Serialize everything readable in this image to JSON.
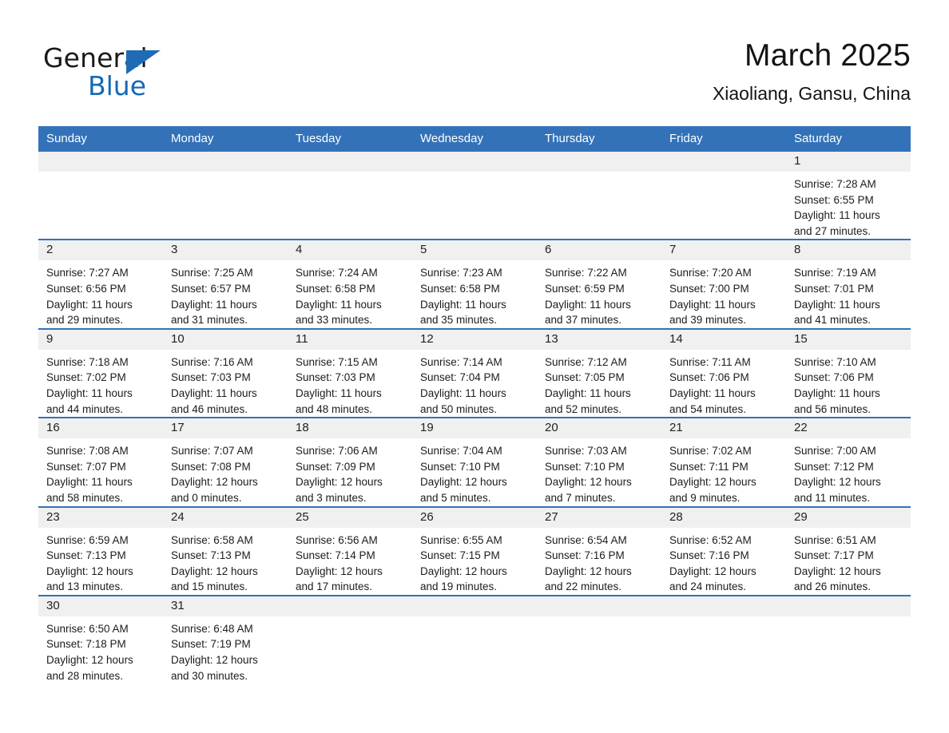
{
  "logo": {
    "word_one": "General",
    "word_two": "Blue",
    "triangle_icon": "blue-triangle-icon",
    "colors": {
      "general": "#1a1a1a",
      "blue": "#1669b5",
      "triangle": "#1e6cb5"
    }
  },
  "header": {
    "title": "March 2025",
    "subtitle": "Xiaoliang, Gansu, China"
  },
  "colors": {
    "header_blue": "#3372b8",
    "row_separator": "#3372b8",
    "daynum_band": "#f0f0f0",
    "cell_background": "#ffffff",
    "text": "#1c1c1c"
  },
  "weekday_headers": [
    "Sunday",
    "Monday",
    "Tuesday",
    "Wednesday",
    "Thursday",
    "Friday",
    "Saturday"
  ],
  "weeks": [
    [
      {
        "day": "",
        "blank": true,
        "sunrise": "",
        "sunset": "",
        "daylight_line1": "",
        "daylight_line2": ""
      },
      {
        "day": "",
        "blank": true,
        "sunrise": "",
        "sunset": "",
        "daylight_line1": "",
        "daylight_line2": ""
      },
      {
        "day": "",
        "blank": true,
        "sunrise": "",
        "sunset": "",
        "daylight_line1": "",
        "daylight_line2": ""
      },
      {
        "day": "",
        "blank": true,
        "sunrise": "",
        "sunset": "",
        "daylight_line1": "",
        "daylight_line2": ""
      },
      {
        "day": "",
        "blank": true,
        "sunrise": "",
        "sunset": "",
        "daylight_line1": "",
        "daylight_line2": ""
      },
      {
        "day": "",
        "blank": true,
        "sunrise": "",
        "sunset": "",
        "daylight_line1": "",
        "daylight_line2": ""
      },
      {
        "day": "1",
        "blank": false,
        "sunrise": "Sunrise: 7:28 AM",
        "sunset": "Sunset: 6:55 PM",
        "daylight_line1": "Daylight: 11 hours",
        "daylight_line2": "and 27 minutes."
      }
    ],
    [
      {
        "day": "2",
        "blank": false,
        "sunrise": "Sunrise: 7:27 AM",
        "sunset": "Sunset: 6:56 PM",
        "daylight_line1": "Daylight: 11 hours",
        "daylight_line2": "and 29 minutes."
      },
      {
        "day": "3",
        "blank": false,
        "sunrise": "Sunrise: 7:25 AM",
        "sunset": "Sunset: 6:57 PM",
        "daylight_line1": "Daylight: 11 hours",
        "daylight_line2": "and 31 minutes."
      },
      {
        "day": "4",
        "blank": false,
        "sunrise": "Sunrise: 7:24 AM",
        "sunset": "Sunset: 6:58 PM",
        "daylight_line1": "Daylight: 11 hours",
        "daylight_line2": "and 33 minutes."
      },
      {
        "day": "5",
        "blank": false,
        "sunrise": "Sunrise: 7:23 AM",
        "sunset": "Sunset: 6:58 PM",
        "daylight_line1": "Daylight: 11 hours",
        "daylight_line2": "and 35 minutes."
      },
      {
        "day": "6",
        "blank": false,
        "sunrise": "Sunrise: 7:22 AM",
        "sunset": "Sunset: 6:59 PM",
        "daylight_line1": "Daylight: 11 hours",
        "daylight_line2": "and 37 minutes."
      },
      {
        "day": "7",
        "blank": false,
        "sunrise": "Sunrise: 7:20 AM",
        "sunset": "Sunset: 7:00 PM",
        "daylight_line1": "Daylight: 11 hours",
        "daylight_line2": "and 39 minutes."
      },
      {
        "day": "8",
        "blank": false,
        "sunrise": "Sunrise: 7:19 AM",
        "sunset": "Sunset: 7:01 PM",
        "daylight_line1": "Daylight: 11 hours",
        "daylight_line2": "and 41 minutes."
      }
    ],
    [
      {
        "day": "9",
        "blank": false,
        "sunrise": "Sunrise: 7:18 AM",
        "sunset": "Sunset: 7:02 PM",
        "daylight_line1": "Daylight: 11 hours",
        "daylight_line2": "and 44 minutes."
      },
      {
        "day": "10",
        "blank": false,
        "sunrise": "Sunrise: 7:16 AM",
        "sunset": "Sunset: 7:03 PM",
        "daylight_line1": "Daylight: 11 hours",
        "daylight_line2": "and 46 minutes."
      },
      {
        "day": "11",
        "blank": false,
        "sunrise": "Sunrise: 7:15 AM",
        "sunset": "Sunset: 7:03 PM",
        "daylight_line1": "Daylight: 11 hours",
        "daylight_line2": "and 48 minutes."
      },
      {
        "day": "12",
        "blank": false,
        "sunrise": "Sunrise: 7:14 AM",
        "sunset": "Sunset: 7:04 PM",
        "daylight_line1": "Daylight: 11 hours",
        "daylight_line2": "and 50 minutes."
      },
      {
        "day": "13",
        "blank": false,
        "sunrise": "Sunrise: 7:12 AM",
        "sunset": "Sunset: 7:05 PM",
        "daylight_line1": "Daylight: 11 hours",
        "daylight_line2": "and 52 minutes."
      },
      {
        "day": "14",
        "blank": false,
        "sunrise": "Sunrise: 7:11 AM",
        "sunset": "Sunset: 7:06 PM",
        "daylight_line1": "Daylight: 11 hours",
        "daylight_line2": "and 54 minutes."
      },
      {
        "day": "15",
        "blank": false,
        "sunrise": "Sunrise: 7:10 AM",
        "sunset": "Sunset: 7:06 PM",
        "daylight_line1": "Daylight: 11 hours",
        "daylight_line2": "and 56 minutes."
      }
    ],
    [
      {
        "day": "16",
        "blank": false,
        "sunrise": "Sunrise: 7:08 AM",
        "sunset": "Sunset: 7:07 PM",
        "daylight_line1": "Daylight: 11 hours",
        "daylight_line2": "and 58 minutes."
      },
      {
        "day": "17",
        "blank": false,
        "sunrise": "Sunrise: 7:07 AM",
        "sunset": "Sunset: 7:08 PM",
        "daylight_line1": "Daylight: 12 hours",
        "daylight_line2": "and 0 minutes."
      },
      {
        "day": "18",
        "blank": false,
        "sunrise": "Sunrise: 7:06 AM",
        "sunset": "Sunset: 7:09 PM",
        "daylight_line1": "Daylight: 12 hours",
        "daylight_line2": "and 3 minutes."
      },
      {
        "day": "19",
        "blank": false,
        "sunrise": "Sunrise: 7:04 AM",
        "sunset": "Sunset: 7:10 PM",
        "daylight_line1": "Daylight: 12 hours",
        "daylight_line2": "and 5 minutes."
      },
      {
        "day": "20",
        "blank": false,
        "sunrise": "Sunrise: 7:03 AM",
        "sunset": "Sunset: 7:10 PM",
        "daylight_line1": "Daylight: 12 hours",
        "daylight_line2": "and 7 minutes."
      },
      {
        "day": "21",
        "blank": false,
        "sunrise": "Sunrise: 7:02 AM",
        "sunset": "Sunset: 7:11 PM",
        "daylight_line1": "Daylight: 12 hours",
        "daylight_line2": "and 9 minutes."
      },
      {
        "day": "22",
        "blank": false,
        "sunrise": "Sunrise: 7:00 AM",
        "sunset": "Sunset: 7:12 PM",
        "daylight_line1": "Daylight: 12 hours",
        "daylight_line2": "and 11 minutes."
      }
    ],
    [
      {
        "day": "23",
        "blank": false,
        "sunrise": "Sunrise: 6:59 AM",
        "sunset": "Sunset: 7:13 PM",
        "daylight_line1": "Daylight: 12 hours",
        "daylight_line2": "and 13 minutes."
      },
      {
        "day": "24",
        "blank": false,
        "sunrise": "Sunrise: 6:58 AM",
        "sunset": "Sunset: 7:13 PM",
        "daylight_line1": "Daylight: 12 hours",
        "daylight_line2": "and 15 minutes."
      },
      {
        "day": "25",
        "blank": false,
        "sunrise": "Sunrise: 6:56 AM",
        "sunset": "Sunset: 7:14 PM",
        "daylight_line1": "Daylight: 12 hours",
        "daylight_line2": "and 17 minutes."
      },
      {
        "day": "26",
        "blank": false,
        "sunrise": "Sunrise: 6:55 AM",
        "sunset": "Sunset: 7:15 PM",
        "daylight_line1": "Daylight: 12 hours",
        "daylight_line2": "and 19 minutes."
      },
      {
        "day": "27",
        "blank": false,
        "sunrise": "Sunrise: 6:54 AM",
        "sunset": "Sunset: 7:16 PM",
        "daylight_line1": "Daylight: 12 hours",
        "daylight_line2": "and 22 minutes."
      },
      {
        "day": "28",
        "blank": false,
        "sunrise": "Sunrise: 6:52 AM",
        "sunset": "Sunset: 7:16 PM",
        "daylight_line1": "Daylight: 12 hours",
        "daylight_line2": "and 24 minutes."
      },
      {
        "day": "29",
        "blank": false,
        "sunrise": "Sunrise: 6:51 AM",
        "sunset": "Sunset: 7:17 PM",
        "daylight_line1": "Daylight: 12 hours",
        "daylight_line2": "and 26 minutes."
      }
    ],
    [
      {
        "day": "30",
        "blank": false,
        "sunrise": "Sunrise: 6:50 AM",
        "sunset": "Sunset: 7:18 PM",
        "daylight_line1": "Daylight: 12 hours",
        "daylight_line2": "and 28 minutes."
      },
      {
        "day": "31",
        "blank": false,
        "sunrise": "Sunrise: 6:48 AM",
        "sunset": "Sunset: 7:19 PM",
        "daylight_line1": "Daylight: 12 hours",
        "daylight_line2": "and 30 minutes."
      },
      {
        "day": "",
        "blank": true,
        "sunrise": "",
        "sunset": "",
        "daylight_line1": "",
        "daylight_line2": ""
      },
      {
        "day": "",
        "blank": true,
        "sunrise": "",
        "sunset": "",
        "daylight_line1": "",
        "daylight_line2": ""
      },
      {
        "day": "",
        "blank": true,
        "sunrise": "",
        "sunset": "",
        "daylight_line1": "",
        "daylight_line2": ""
      },
      {
        "day": "",
        "blank": true,
        "sunrise": "",
        "sunset": "",
        "daylight_line1": "",
        "daylight_line2": ""
      },
      {
        "day": "",
        "blank": true,
        "sunrise": "",
        "sunset": "",
        "daylight_line1": "",
        "daylight_line2": ""
      }
    ]
  ]
}
